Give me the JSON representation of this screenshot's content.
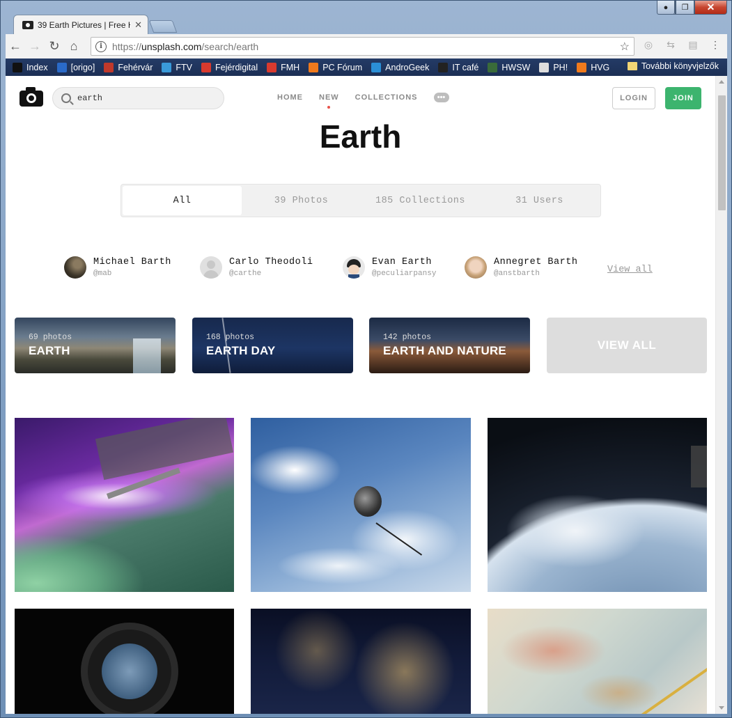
{
  "browser": {
    "tab_title": "39 Earth Pictures | Free H",
    "tab_close": "✕",
    "url_scheme": "https://",
    "url_host": "unsplash.com",
    "url_path": "/search/earth",
    "window_buttons": {
      "minimize": "▬",
      "maximize": "❐",
      "close": "✕"
    },
    "bookmarks": [
      {
        "label": "Index",
        "color": "#111111"
      },
      {
        "label": "[origo]",
        "color": "#2a6ac8"
      },
      {
        "label": "Fehérvár",
        "color": "#c0392b"
      },
      {
        "label": "FTV",
        "color": "#3a9ad9"
      },
      {
        "label": "Fejérdigital",
        "color": "#d93a2e"
      },
      {
        "label": "FMH",
        "color": "#d93a2e"
      },
      {
        "label": "PC Fórum",
        "color": "#f07a1c"
      },
      {
        "label": "AndroGeek",
        "color": "#2b8fd6"
      },
      {
        "label": "IT café",
        "color": "#222222"
      },
      {
        "label": "HWSW",
        "color": "#3a6b3a"
      },
      {
        "label": "PH!",
        "color": "#dddddd"
      },
      {
        "label": "HVG",
        "color": "#f07a1c"
      }
    ],
    "other_bookmarks": "További könyvjelzők"
  },
  "header": {
    "search_value": "earth",
    "nav": [
      {
        "label": "HOME",
        "active": false
      },
      {
        "label": "NEW",
        "active": true
      },
      {
        "label": "COLLECTIONS",
        "active": false
      }
    ],
    "more_label": "•••",
    "login_label": "LOGIN",
    "join_label": "JOIN",
    "join_color": "#3cb46e"
  },
  "page_title": "Earth",
  "filter_tabs": [
    {
      "label": "All",
      "active": true
    },
    {
      "label": "39 Photos",
      "active": false
    },
    {
      "label": "185 Collections",
      "active": false
    },
    {
      "label": "31 Users",
      "active": false
    }
  ],
  "users": [
    {
      "name": "Michael Barth",
      "handle": "@mab"
    },
    {
      "name": "Carlo Theodoli",
      "handle": "@carthe"
    },
    {
      "name": "Evan Earth",
      "handle": "@peculiarpansy"
    },
    {
      "name": "Annegret Barth",
      "handle": "@anstbarth"
    }
  ],
  "users_view_all": "View all",
  "collections": [
    {
      "count": "69 photos",
      "title": "EARTH"
    },
    {
      "count": "168 photos",
      "title": "EARTH DAY"
    },
    {
      "count": "142 photos",
      "title": "EARTH AND NATURE"
    }
  ],
  "collections_view_all": "VIEW ALL",
  "photos": [
    {
      "subject": "space station over aurora"
    },
    {
      "subject": "spacecraft over clouds"
    },
    {
      "subject": "earth from orbit"
    },
    {
      "subject": "cupola window"
    },
    {
      "subject": "city lights at night"
    },
    {
      "subject": "globe map"
    }
  ]
}
